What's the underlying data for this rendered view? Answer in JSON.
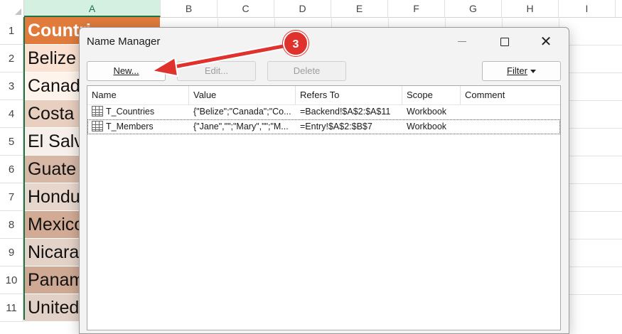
{
  "spreadsheet": {
    "columns": [
      "A",
      "B",
      "C",
      "D",
      "E",
      "F",
      "G",
      "H",
      "I"
    ],
    "rows": [
      "1",
      "2",
      "3",
      "4",
      "5",
      "6",
      "7",
      "8",
      "9",
      "10",
      "11"
    ],
    "cells_a": [
      "Countri",
      "Belize",
      "Canad",
      "Costa",
      "El Salv",
      "Guate",
      "Hondu",
      "Mexico",
      "Nicara",
      "Panam",
      "United"
    ],
    "header_color": "#e07b3c",
    "selection_color": "#217346"
  },
  "dialog": {
    "title": "Name Manager",
    "buttons": {
      "new": "New...",
      "edit": "Edit...",
      "delete": "Delete",
      "filter": "Filter"
    },
    "columns": [
      "Name",
      "Value",
      "Refers To",
      "Scope",
      "Comment"
    ],
    "names": [
      {
        "name": "T_Countries",
        "value": "{\"Belize\";\"Canada\";\"Co...",
        "refers_to": "=Backend!$A$2:$A$11",
        "scope": "Workbook",
        "comment": "",
        "icon": "table-icon"
      },
      {
        "name": "T_Members",
        "value": "{\"Jane\",\"\";\"Mary\",\"\";\"M...",
        "refers_to": "=Entry!$A$2:$B$7",
        "scope": "Workbook",
        "comment": "",
        "icon": "table-icon"
      }
    ]
  },
  "annotation": {
    "step": "3",
    "color": "#e0322d"
  }
}
